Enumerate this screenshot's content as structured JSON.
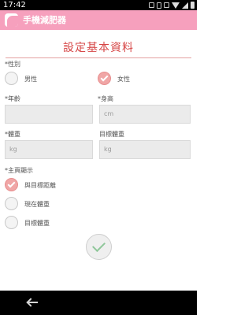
{
  "status_bar": {
    "time": "17:42",
    "icons": [
      "notification-icon",
      "vibrate-icon",
      "mute-icon",
      "wifi-icon",
      "signal-icon",
      "battery-icon"
    ]
  },
  "app_bar": {
    "title": "手機減肥器",
    "color": "#f6a0bd"
  },
  "page": {
    "title": "設定基本資料",
    "accent": "#d64545"
  },
  "gender": {
    "label": "*性別",
    "options": [
      {
        "label": "男性",
        "checked": false
      },
      {
        "label": "女性",
        "checked": true
      }
    ]
  },
  "age": {
    "label": "*年齡",
    "placeholder": ""
  },
  "height": {
    "label": "*身高",
    "placeholder": "cm"
  },
  "weight": {
    "label": "*體重",
    "placeholder": "kg"
  },
  "target_weight": {
    "label": "目標體重",
    "placeholder": "kg"
  },
  "homepage_display": {
    "label": "*主頁顯示",
    "options": [
      {
        "label": "與目標距離",
        "checked": true
      },
      {
        "label": "現在體重",
        "checked": false
      },
      {
        "label": "目標體重",
        "checked": false
      }
    ]
  },
  "confirm": {
    "icon": "check-icon",
    "color": "#8fc79a"
  },
  "nav_bar": {
    "back_icon": "back-arrow-icon"
  }
}
